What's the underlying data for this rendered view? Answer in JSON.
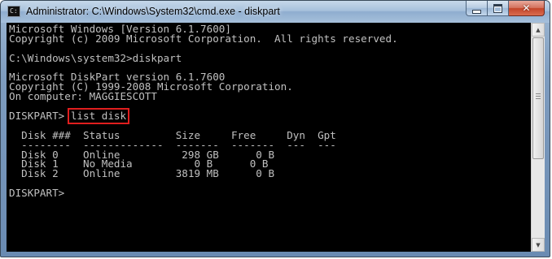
{
  "window": {
    "title": "Administrator: C:\\Windows\\System32\\cmd.exe - diskpart",
    "icons": {
      "app": "command-prompt-icon",
      "minimize": "minimize-icon",
      "maximize": "maximize-icon",
      "close": "close-icon"
    }
  },
  "console": {
    "lines": [
      "Microsoft Windows [Version 6.1.7600]",
      "Copyright (c) 2009 Microsoft Corporation.  All rights reserved.",
      "",
      "C:\\Windows\\system32>diskpart",
      "",
      "Microsoft DiskPart version 6.1.7600",
      "Copyright (C) 1999-2008 Microsoft Corporation.",
      "On computer: MAGGIESCOTT",
      "",
      "DISKPART> "
    ],
    "highlighted_command": "list disk",
    "table": {
      "header": "  Disk ###  Status         Size     Free     Dyn  Gpt",
      "separator": "  --------  -------------  -------  -------  ---  ---",
      "rows": [
        "  Disk 0    Online          298 GB      0 B",
        "  Disk 1    No Media          0 B      0 B",
        "  Disk 2    Online         3819 MB      0 B"
      ]
    },
    "final_prompt": "DISKPART> ",
    "colors": {
      "background": "#000000",
      "text": "#c0c0c0",
      "highlight_box": "#e01e1e"
    }
  }
}
